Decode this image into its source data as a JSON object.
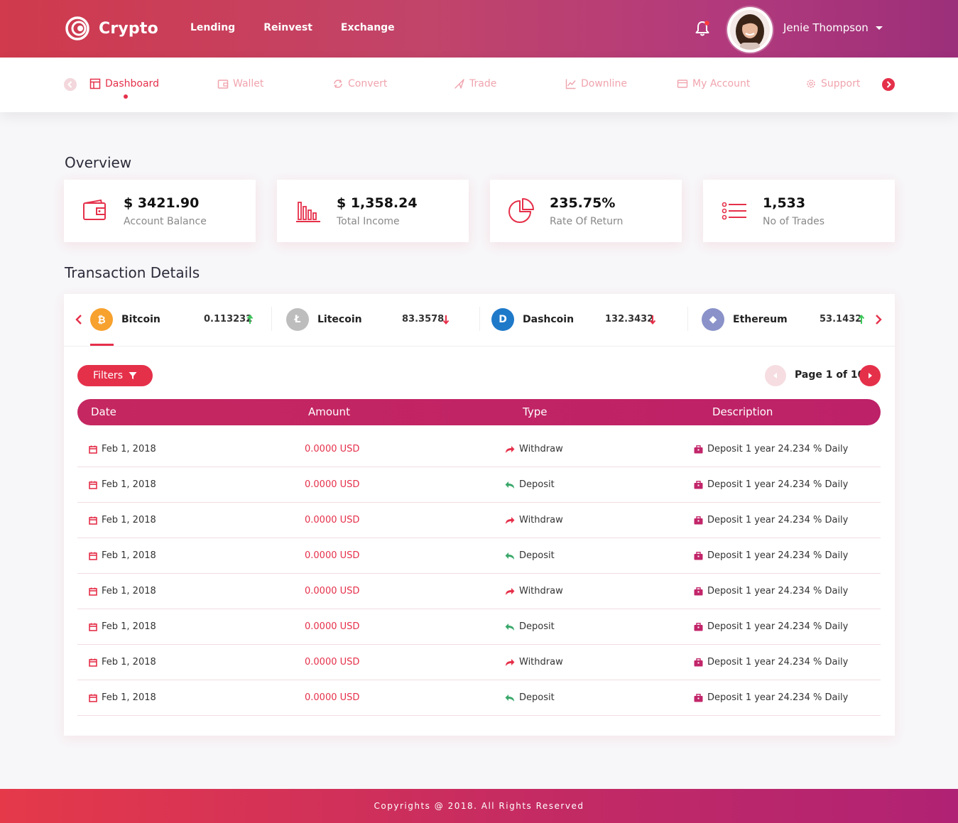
{
  "header": {
    "brand": "Crypto",
    "nav": [
      "Lending",
      "Reinvest",
      "Exchange"
    ],
    "user_name": "Jenie Thompson"
  },
  "subnav": {
    "items": [
      {
        "label": "Dashboard",
        "icon": "dashboard-icon",
        "active": true
      },
      {
        "label": "Wallet",
        "icon": "wallet-icon",
        "active": false
      },
      {
        "label": "Convert",
        "icon": "convert-icon",
        "active": false
      },
      {
        "label": "Trade",
        "icon": "trade-icon",
        "active": false
      },
      {
        "label": "Downline",
        "icon": "chart-line-icon",
        "active": false
      },
      {
        "label": "My Account",
        "icon": "card-icon",
        "active": false
      },
      {
        "label": "Support",
        "icon": "gear-icon",
        "active": false
      }
    ]
  },
  "overview": {
    "title": "Overview",
    "cards": [
      {
        "value": "$ 3421.90",
        "label": "Account Balance",
        "icon": "wallet-icon"
      },
      {
        "value": "$ 1,358.24",
        "label": "Total Income",
        "icon": "bar-chart-icon"
      },
      {
        "value": "235.75%",
        "label": "Rate Of Return",
        "icon": "pie-chart-icon"
      },
      {
        "value": "1,533",
        "label": "No of Trades",
        "icon": "list-icon"
      }
    ]
  },
  "transactions": {
    "title": "Transaction Details",
    "coins": [
      {
        "name": "Bitcoin",
        "value": "0.113232",
        "trend": "up",
        "color": "#f7a12e",
        "symbol": "₿"
      },
      {
        "name": "Litecoin",
        "value": "83.3578",
        "trend": "down",
        "color": "#bdbdbd",
        "symbol": "Ł"
      },
      {
        "name": "Dashcoin",
        "value": "132.3432",
        "trend": "down",
        "color": "#1e79c9",
        "symbol": "D"
      },
      {
        "name": "Ethereum",
        "value": "53.1432",
        "trend": "up",
        "color": "#8a92c9",
        "symbol": "◆"
      }
    ],
    "filters_label": "Filters",
    "pager_text": "Page 1 of 10",
    "columns": [
      "Date",
      "Amount",
      "Type",
      "Description"
    ],
    "rows": [
      {
        "date": "Feb 1, 2018",
        "amount": "0.0000 USD",
        "type": "Withdraw",
        "desc": "Deposit 1 year 24.234 % Daily"
      },
      {
        "date": "Feb 1, 2018",
        "amount": "0.0000 USD",
        "type": "Deposit",
        "desc": "Deposit 1 year 24.234 % Daily"
      },
      {
        "date": "Feb 1, 2018",
        "amount": "0.0000 USD",
        "type": "Withdraw",
        "desc": "Deposit 1 year 24.234 % Daily"
      },
      {
        "date": "Feb 1, 2018",
        "amount": "0.0000 USD",
        "type": "Deposit",
        "desc": "Deposit 1 year 24.234 % Daily"
      },
      {
        "date": "Feb 1, 2018",
        "amount": "0.0000 USD",
        "type": "Withdraw",
        "desc": "Deposit 1 year 24.234 % Daily"
      },
      {
        "date": "Feb 1, 2018",
        "amount": "0.0000 USD",
        "type": "Deposit",
        "desc": "Deposit 1 year 24.234 % Daily"
      },
      {
        "date": "Feb 1, 2018",
        "amount": "0.0000 USD",
        "type": "Withdraw",
        "desc": "Deposit 1 year 24.234 % Daily"
      },
      {
        "date": "Feb 1, 2018",
        "amount": "0.0000 USD",
        "type": "Deposit",
        "desc": "Deposit 1 year 24.234 % Daily"
      }
    ]
  },
  "footer": {
    "text": "Copyrights @ 2018. All Rights Reserved"
  },
  "colors": {
    "accent": "#e5304a",
    "header_pink": "#c52760",
    "up": "#3cc85a",
    "down": "#e5304a",
    "deposit": "#3aa86a",
    "withdraw": "#e5304a"
  }
}
